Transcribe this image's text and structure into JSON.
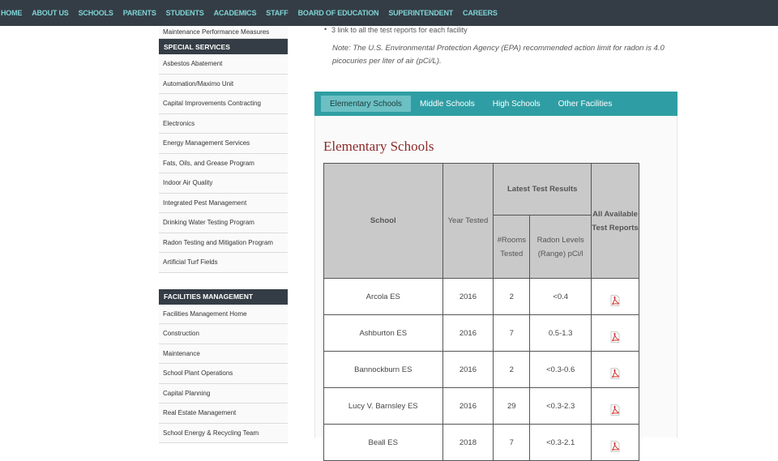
{
  "nav": [
    "HOME",
    "ABOUT US",
    "SCHOOLS",
    "PARENTS",
    "STUDENTS",
    "ACADEMICS",
    "STAFF",
    "BOARD OF EDUCATION",
    "SUPERINTENDENT",
    "CAREERS"
  ],
  "sidebar": {
    "top_item": "Maintenance Performance Measures",
    "special_heading": "SPECIAL SERVICES",
    "special_items": [
      "Asbestos Abatement",
      "Automation/Maximo Unit",
      "Capital Improvements Contracting",
      "Electronics",
      "Energy Management Services",
      "Fats, Oils, and Grease Program",
      "Indoor Air Quality",
      "Integrated Pest Management",
      "Drinking Water Testing Program",
      "Radon Testing and Mitigation Program",
      "Artificial Turf Fields"
    ],
    "facilities_heading": "FACILITIES MANAGEMENT",
    "facilities_items": [
      "Facilities Management Home",
      "Construction",
      "Maintenance",
      "School Plant Operations",
      "Capital Planning",
      "Real Estate Management",
      "School Energy & Recycling Team"
    ]
  },
  "main": {
    "bullet": "3 link to all the test reports for each facility",
    "note": "Note: The U.S. Environmental Protection Agency (EPA) recommended action limit for radon is 4.0 picocuries per liter of air (pCi/L).",
    "tabs": [
      "Elementary Schools",
      "Middle Schools",
      "High Schools",
      "Other Facilities"
    ],
    "section_title": "Elementary Schools",
    "table": {
      "h_school": "School",
      "h_year": "Year Tested",
      "h_latest": "Latest Test Results",
      "h_all": "All Available Test Reports",
      "h_rooms": "#Rooms Tested",
      "h_radon": "Radon Levels (Range) pCi/l",
      "rows": [
        {
          "school": "Arcola ES",
          "year": "2016",
          "rooms": "2",
          "radon": "<0.4"
        },
        {
          "school": "Ashburton ES",
          "year": "2016",
          "rooms": "7",
          "radon": "0.5-1.3"
        },
        {
          "school": "Bannockburn ES",
          "year": "2016",
          "rooms": "2",
          "radon": "<0.3-0.6"
        },
        {
          "school": "Lucy V. Barnsley ES",
          "year": "2016",
          "rooms": "29",
          "radon": "<0.3-2.3"
        },
        {
          "school": "Beall ES",
          "year": "2018",
          "rooms": "7",
          "radon": "<0.3-2.1"
        }
      ]
    }
  },
  "colors": {
    "nav_bg": "#343d45",
    "nav_text": "#7fd3d6",
    "tab_bar": "#2f9ea4",
    "title_red": "#8b2a2a",
    "pdf_red": "#d0302c"
  }
}
